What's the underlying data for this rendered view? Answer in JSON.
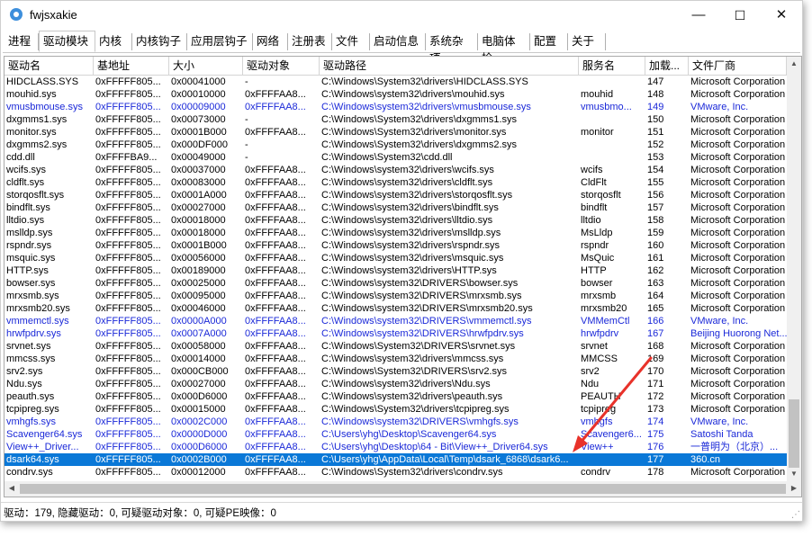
{
  "window": {
    "title": "fwjsxakie",
    "minimize": "—",
    "maximize": "☐",
    "close": "✕"
  },
  "tabs": [
    "进程",
    "驱动模块",
    "内核",
    "内核钩子",
    "应用层钩子",
    "网络",
    "注册表",
    "文件",
    "启动信息",
    "系统杂项",
    "电脑体检",
    "配置",
    "关于"
  ],
  "active_tab": 1,
  "columns": [
    "驱动名",
    "基地址",
    "大小",
    "驱动对象",
    "驱动路径",
    "服务名",
    "加载...",
    "文件厂商"
  ],
  "rows": [
    {
      "c": [
        "HIDCLASS.SYS",
        "0xFFFFF805...",
        "0x00041000",
        "-",
        "C:\\Windows\\System32\\drivers\\HIDCLASS.SYS",
        "",
        "147",
        "Microsoft Corporation"
      ],
      "t": "normal"
    },
    {
      "c": [
        "mouhid.sys",
        "0xFFFFF805...",
        "0x00010000",
        "0xFFFFAA8...",
        "C:\\Windows\\system32\\drivers\\mouhid.sys",
        "mouhid",
        "148",
        "Microsoft Corporation"
      ],
      "t": "normal"
    },
    {
      "c": [
        "vmusbmouse.sys",
        "0xFFFFF805...",
        "0x00009000",
        "0xFFFFAA8...",
        "C:\\Windows\\system32\\drivers\\vmusbmouse.sys",
        "vmusbmo...",
        "149",
        "VMware, Inc."
      ],
      "t": "blue"
    },
    {
      "c": [
        "dxgmms1.sys",
        "0xFFFFF805...",
        "0x00073000",
        "-",
        "C:\\Windows\\System32\\drivers\\dxgmms1.sys",
        "",
        "150",
        "Microsoft Corporation"
      ],
      "t": "normal"
    },
    {
      "c": [
        "monitor.sys",
        "0xFFFFF805...",
        "0x0001B000",
        "0xFFFFAA8...",
        "C:\\Windows\\System32\\drivers\\monitor.sys",
        "monitor",
        "151",
        "Microsoft Corporation"
      ],
      "t": "normal"
    },
    {
      "c": [
        "dxgmms2.sys",
        "0xFFFFF805...",
        "0x000DF000",
        "-",
        "C:\\Windows\\System32\\drivers\\dxgmms2.sys",
        "",
        "152",
        "Microsoft Corporation"
      ],
      "t": "normal"
    },
    {
      "c": [
        "cdd.dll",
        "0xFFFFBA9...",
        "0x00049000",
        "-",
        "C:\\Windows\\System32\\cdd.dll",
        "",
        "153",
        "Microsoft Corporation"
      ],
      "t": "normal"
    },
    {
      "c": [
        "wcifs.sys",
        "0xFFFFF805...",
        "0x00037000",
        "0xFFFFAA8...",
        "C:\\Windows\\system32\\drivers\\wcifs.sys",
        "wcifs",
        "154",
        "Microsoft Corporation"
      ],
      "t": "normal"
    },
    {
      "c": [
        "cldflt.sys",
        "0xFFFFF805...",
        "0x00083000",
        "0xFFFFAA8...",
        "C:\\Windows\\system32\\drivers\\cldflt.sys",
        "CldFlt",
        "155",
        "Microsoft Corporation"
      ],
      "t": "normal"
    },
    {
      "c": [
        "storqosflt.sys",
        "0xFFFFF805...",
        "0x0001A000",
        "0xFFFFAA8...",
        "C:\\Windows\\system32\\drivers\\storqosflt.sys",
        "storqosflt",
        "156",
        "Microsoft Corporation"
      ],
      "t": "normal"
    },
    {
      "c": [
        "bindflt.sys",
        "0xFFFFF805...",
        "0x00027000",
        "0xFFFFAA8...",
        "C:\\Windows\\system32\\drivers\\bindflt.sys",
        "bindflt",
        "157",
        "Microsoft Corporation"
      ],
      "t": "normal"
    },
    {
      "c": [
        "lltdio.sys",
        "0xFFFFF805...",
        "0x00018000",
        "0xFFFFAA8...",
        "C:\\Windows\\system32\\drivers\\lltdio.sys",
        "lltdio",
        "158",
        "Microsoft Corporation"
      ],
      "t": "normal"
    },
    {
      "c": [
        "mslldp.sys",
        "0xFFFFF805...",
        "0x00018000",
        "0xFFFFAA8...",
        "C:\\Windows\\system32\\drivers\\mslldp.sys",
        "MsLldp",
        "159",
        "Microsoft Corporation"
      ],
      "t": "normal"
    },
    {
      "c": [
        "rspndr.sys",
        "0xFFFFF805...",
        "0x0001B000",
        "0xFFFFAA8...",
        "C:\\Windows\\system32\\drivers\\rspndr.sys",
        "rspndr",
        "160",
        "Microsoft Corporation"
      ],
      "t": "normal"
    },
    {
      "c": [
        "msquic.sys",
        "0xFFFFF805...",
        "0x00056000",
        "0xFFFFAA8...",
        "C:\\Windows\\system32\\drivers\\msquic.sys",
        "MsQuic",
        "161",
        "Microsoft Corporation"
      ],
      "t": "normal"
    },
    {
      "c": [
        "HTTP.sys",
        "0xFFFFF805...",
        "0x00189000",
        "0xFFFFAA8...",
        "C:\\Windows\\system32\\drivers\\HTTP.sys",
        "HTTP",
        "162",
        "Microsoft Corporation"
      ],
      "t": "normal"
    },
    {
      "c": [
        "bowser.sys",
        "0xFFFFF805...",
        "0x00025000",
        "0xFFFFAA8...",
        "C:\\Windows\\system32\\DRIVERS\\bowser.sys",
        "bowser",
        "163",
        "Microsoft Corporation"
      ],
      "t": "normal"
    },
    {
      "c": [
        "mrxsmb.sys",
        "0xFFFFF805...",
        "0x00095000",
        "0xFFFFAA8...",
        "C:\\Windows\\system32\\DRIVERS\\mrxsmb.sys",
        "mrxsmb",
        "164",
        "Microsoft Corporation"
      ],
      "t": "normal"
    },
    {
      "c": [
        "mrxsmb20.sys",
        "0xFFFFF805...",
        "0x00046000",
        "0xFFFFAA8...",
        "C:\\Windows\\system32\\DRIVERS\\mrxsmb20.sys",
        "mrxsmb20",
        "165",
        "Microsoft Corporation"
      ],
      "t": "normal"
    },
    {
      "c": [
        "vmmemctl.sys",
        "0xFFFFF805...",
        "0x0000A000",
        "0xFFFFAA8...",
        "C:\\Windows\\system32\\DRIVERS\\vmmemctl.sys",
        "VMMemCtl",
        "166",
        "VMware, Inc."
      ],
      "t": "blue"
    },
    {
      "c": [
        "hrwfpdrv.sys",
        "0xFFFFF805...",
        "0x0007A000",
        "0xFFFFAA8...",
        "C:\\Windows\\system32\\DRIVERS\\hrwfpdrv.sys",
        "hrwfpdrv",
        "167",
        "Beijing Huorong Net..."
      ],
      "t": "blue"
    },
    {
      "c": [
        "srvnet.sys",
        "0xFFFFF805...",
        "0x00058000",
        "0xFFFFAA8...",
        "C:\\Windows\\System32\\DRIVERS\\srvnet.sys",
        "srvnet",
        "168",
        "Microsoft Corporation"
      ],
      "t": "normal"
    },
    {
      "c": [
        "mmcss.sys",
        "0xFFFFF805...",
        "0x00014000",
        "0xFFFFAA8...",
        "C:\\Windows\\system32\\drivers\\mmcss.sys",
        "MMCSS",
        "169",
        "Microsoft Corporation"
      ],
      "t": "normal"
    },
    {
      "c": [
        "srv2.sys",
        "0xFFFFF805...",
        "0x000CB000",
        "0xFFFFAA8...",
        "C:\\Windows\\System32\\DRIVERS\\srv2.sys",
        "srv2",
        "170",
        "Microsoft Corporation"
      ],
      "t": "normal"
    },
    {
      "c": [
        "Ndu.sys",
        "0xFFFFF805...",
        "0x00027000",
        "0xFFFFAA8...",
        "C:\\Windows\\system32\\drivers\\Ndu.sys",
        "Ndu",
        "171",
        "Microsoft Corporation"
      ],
      "t": "normal"
    },
    {
      "c": [
        "peauth.sys",
        "0xFFFFF805...",
        "0x000D6000",
        "0xFFFFAA8...",
        "C:\\Windows\\system32\\drivers\\peauth.sys",
        "PEAUTH",
        "172",
        "Microsoft Corporation"
      ],
      "t": "normal"
    },
    {
      "c": [
        "tcpipreg.sys",
        "0xFFFFF805...",
        "0x00015000",
        "0xFFFFAA8...",
        "C:\\Windows\\System32\\drivers\\tcpipreg.sys",
        "tcpipreg",
        "173",
        "Microsoft Corporation"
      ],
      "t": "normal"
    },
    {
      "c": [
        "vmhgfs.sys",
        "0xFFFFF805...",
        "0x0002C000",
        "0xFFFFAA8...",
        "C:\\Windows\\system32\\DRIVERS\\vmhgfs.sys",
        "vmhgfs",
        "174",
        "VMware, Inc."
      ],
      "t": "blue"
    },
    {
      "c": [
        "Scavenger64.sys",
        "0xFFFFF805...",
        "0x0000D000",
        "0xFFFFAA8...",
        "C:\\Users\\yhg\\Desktop\\Scavenger64.sys",
        "Scavenger6...",
        "175",
        "Satoshi Tanda"
      ],
      "t": "blue"
    },
    {
      "c": [
        "View++_Driver...",
        "0xFFFFF805...",
        "0x000D6000",
        "0xFFFFAA8...",
        "C:\\Users\\yhg\\Desktop\\64 - Bit\\View++_Driver64.sys",
        "View++",
        "176",
        "一普明为（北京）..."
      ],
      "t": "blue"
    },
    {
      "c": [
        "dsark64.sys",
        "0xFFFFF805...",
        "0x0002B000",
        "0xFFFFAA8...",
        "C:\\Users\\yhg\\AppData\\Local\\Temp\\dsark_6868\\dsark6...",
        "",
        "177",
        "360.cn"
      ],
      "t": "sel"
    },
    {
      "c": [
        "condrv.sys",
        "0xFFFFF805...",
        "0x00012000",
        "0xFFFFAA8...",
        "C:\\Windows\\System32\\drivers\\condrv.sys",
        "condrv",
        "178",
        "Microsoft Corporation"
      ],
      "t": "normal"
    }
  ],
  "status": "驱动：179, 隐藏驱动：0, 可疑驱动对象：0, 可疑PE映像：0",
  "colors": {
    "selection": "#0a78d7",
    "signed_other": "#1a28d8",
    "annotation_arrow": "#e8322a"
  }
}
